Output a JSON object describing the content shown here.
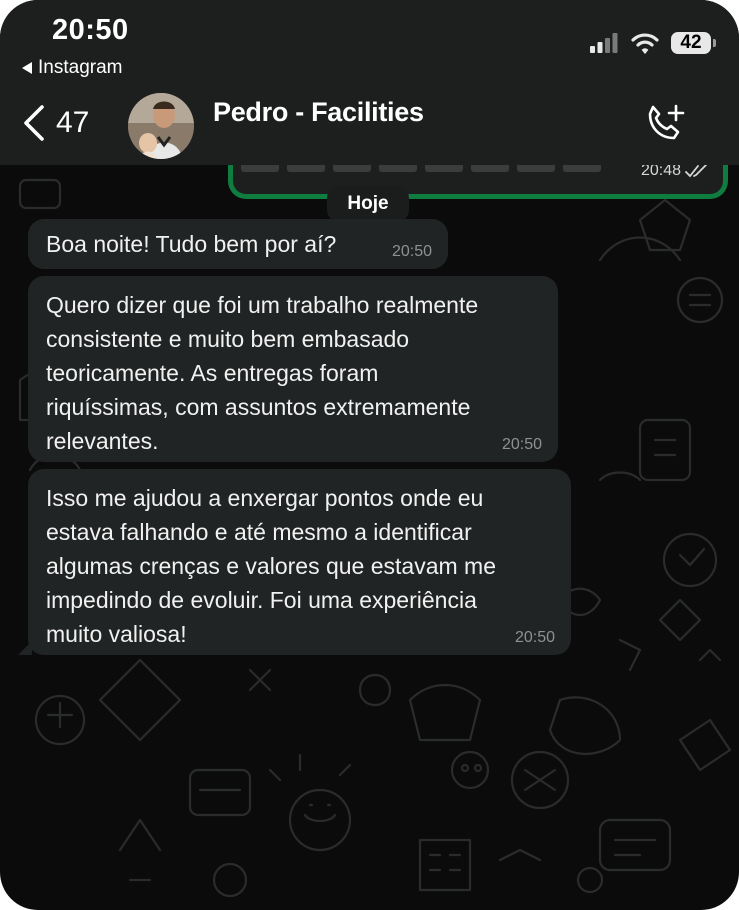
{
  "status_bar": {
    "time": "20:50",
    "back_app_label": "Instagram",
    "battery": "42"
  },
  "header": {
    "back_count": "47",
    "contact_name": "Pedro - Facilities"
  },
  "chat": {
    "previous_message_time": "20:48",
    "date_separator": "Hoje",
    "messages": [
      {
        "text": "Boa noite! Tudo bem por aí?",
        "time": "20:50"
      },
      {
        "text": "Quero dizer que foi um trabalho realmente\nconsistente e muito bem embasado\nteoricamente. As entregas foram\nriquíssimas, com assuntos extremamente\nrelevantes.",
        "time": "20:50"
      },
      {
        "text": "Isso me ajudou a enxergar pontos onde eu\nestava falhando e até mesmo a identificar\nalgumas crenças e valores que estavam me\nimpedindo de evoluir. Foi uma experiência\nmuito valiosa!",
        "time": "20:50"
      }
    ]
  },
  "icons": {
    "back": "chevron-left-icon",
    "call": "phone-add-icon",
    "signal": "cellular-signal-icon",
    "wifi": "wifi-icon",
    "read": "double-check-icon"
  },
  "colors": {
    "background": "#0b0b0b",
    "header": "#1d1f1f",
    "bubble_incoming": "#212424",
    "timestamp": "#8d9192",
    "outgoing_border": "#0f7d40"
  }
}
